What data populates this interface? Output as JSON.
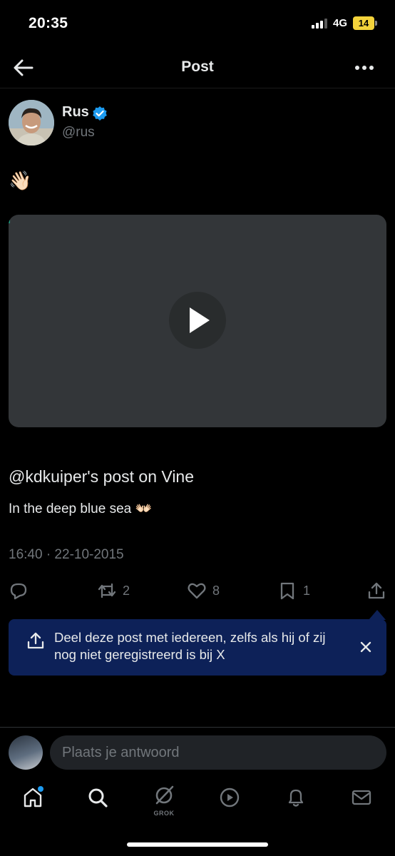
{
  "status_bar": {
    "time": "20:35",
    "network": "4G",
    "battery": "14"
  },
  "header": {
    "title": "Post",
    "back_icon": "arrow-left-icon",
    "more_icon": "ellipsis-icon"
  },
  "post": {
    "author_name": "Rus",
    "author_handle": "@rus",
    "verified": true,
    "emoji": "👋🏻",
    "video": {
      "icon": "play-icon"
    },
    "link_title": "@kdkuiper's post on Vine",
    "link_description": "In the deep blue sea 👐🏻",
    "timestamp": "16:40 · 22-10-2015"
  },
  "actions": {
    "reply": {
      "icon": "reply-icon",
      "count": ""
    },
    "repost": {
      "icon": "repost-icon",
      "count": "2"
    },
    "like": {
      "icon": "heart-icon",
      "count": "8"
    },
    "bookmark": {
      "icon": "bookmark-icon",
      "count": "1"
    },
    "share": {
      "icon": "share-icon",
      "count": ""
    }
  },
  "tooltip": {
    "text": "Deel deze post met iedereen, zelfs als hij of zij nog niet geregistreerd is bij X",
    "icon": "share-icon",
    "close_icon": "close-icon"
  },
  "reply_bar": {
    "placeholder": "Plaats je antwoord"
  },
  "tabbar": {
    "items": [
      {
        "name": "home",
        "icon": "home-icon",
        "has_notification": true
      },
      {
        "name": "search",
        "icon": "search-icon"
      },
      {
        "name": "grok",
        "icon": "grok-icon",
        "label": "GROK"
      },
      {
        "name": "video",
        "icon": "play-circle-icon"
      },
      {
        "name": "notifications",
        "icon": "bell-icon"
      },
      {
        "name": "messages",
        "icon": "mail-icon"
      }
    ]
  },
  "colors": {
    "background": "#000000",
    "text": "#e7e9ea",
    "muted": "#71767b",
    "accent": "#1d9bf0",
    "tooltip_bg": "#0d2158",
    "battery": "#f4d33b"
  }
}
